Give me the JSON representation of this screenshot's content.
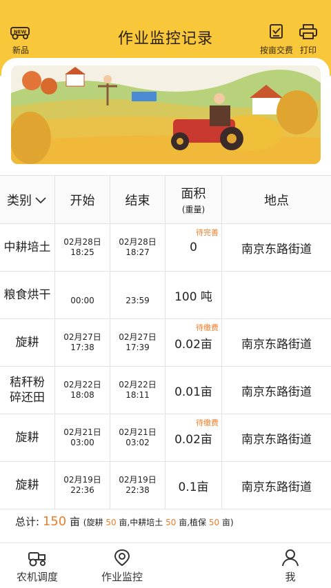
{
  "header": {
    "title": "作业监控记录",
    "new_label": "新品",
    "pay_label": "按亩交费",
    "print_label": "打印",
    "background": "#f8c83a"
  },
  "table": {
    "columns": {
      "category": "类别",
      "start": "开始",
      "end": "结束",
      "area": "面积",
      "area_sub": "(重量)",
      "location": "地点"
    },
    "rows": [
      {
        "category": "中耕培土",
        "start_date": "02月28日",
        "start_time": "18:25",
        "end_date": "02月28日",
        "end_time": "18:27",
        "area": "0",
        "tag": "待完善",
        "location": "南京东路街道"
      },
      {
        "category": "粮食烘干",
        "start_date": "",
        "start_time": "00:00",
        "end_date": "",
        "end_time": "23:59",
        "area": "100 吨",
        "tag": "",
        "location": ""
      },
      {
        "category": "旋耕",
        "start_date": "02月27日",
        "start_time": "17:38",
        "end_date": "02月27日",
        "end_time": "17:39",
        "area": "0.02亩",
        "tag": "待缴费",
        "location": "南京东路街道"
      },
      {
        "category": "秸秆粉碎还田",
        "start_date": "02月22日",
        "start_time": "18:08",
        "end_date": "02月22日",
        "end_time": "18:11",
        "area": "0.01亩",
        "tag": "",
        "location": "南京东路街道"
      },
      {
        "category": "旋耕",
        "start_date": "02月21日",
        "start_time": "03:00",
        "end_date": "02月21日",
        "end_time": "03:02",
        "area": "0.02亩",
        "tag": "待缴费",
        "location": "南京东路街道"
      },
      {
        "category": "旋耕",
        "start_date": "02月19日",
        "start_time": "22:36",
        "end_date": "02月19日",
        "end_time": "22:38",
        "area": "0.1亩",
        "tag": "",
        "location": "南京东路街道"
      }
    ]
  },
  "summary": {
    "label": "总计:",
    "total_value": "150",
    "total_unit": "亩",
    "open": "(",
    "item1_name": "旋耕",
    "item1_value": "50",
    "item1_unit": "亩,",
    "item2_name": "中耕培土",
    "item2_value": "50",
    "item2_unit": "亩,",
    "item3_name": "植保",
    "item3_value": "50",
    "item3_unit": "亩",
    "close": ")",
    "accent": "#ef7d2a"
  },
  "nav": {
    "item1": "农机调度",
    "item2": "作业监控",
    "item3": "我"
  }
}
